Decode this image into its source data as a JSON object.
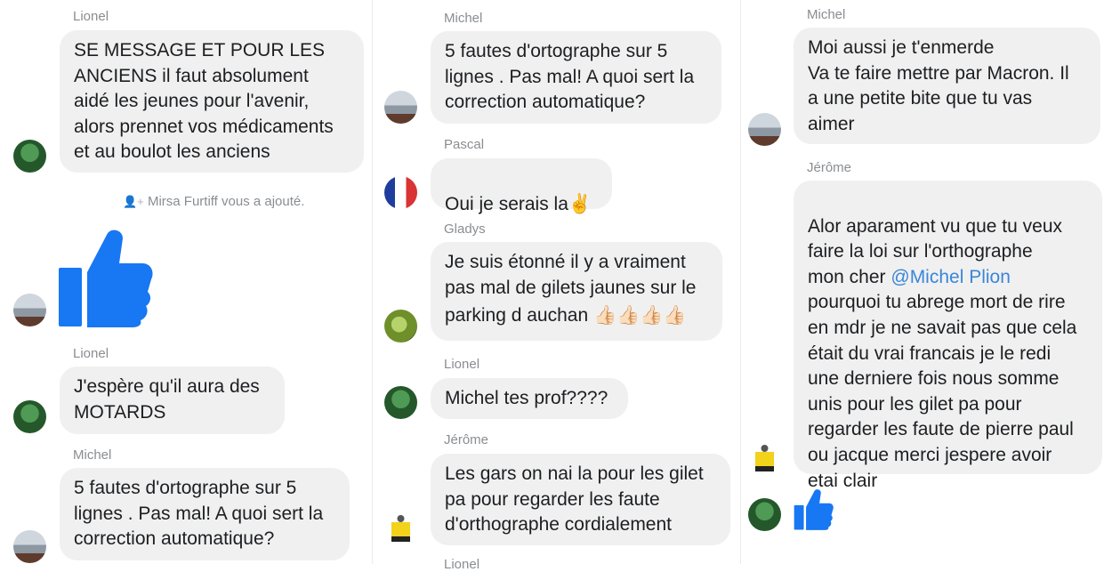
{
  "col1": {
    "name_lionel_1": "Lionel",
    "msg_lionel_1": "SE MESSAGE ET POUR LES\nANCIENS il faut absolument\naidé les jeunes pour l'avenir,\nalors prennet vos médicaments\net au boulot les anciens",
    "system_added": "Mirsa Furtiff vous a ajouté.",
    "name_lionel_2": "Lionel",
    "msg_lionel_2": "J'espère qu'il aura des\nMOTARDS",
    "name_michel": "Michel",
    "msg_michel": "5 fautes d'ortographe sur 5\nlignes . Pas mal! A quoi sert la\ncorrection automatique?"
  },
  "col2": {
    "name_michel": "Michel",
    "msg_michel": "5 fautes d'ortographe sur 5\nlignes . Pas mal! A quoi sert la\ncorrection automatique?",
    "name_pascal": "Pascal",
    "msg_pascal": "Oui je serais la",
    "name_gladys": "Gladys",
    "msg_gladys_line1": "Je suis étonné il y a vraiment",
    "msg_gladys_line2": "pas mal de gilets jaunes sur le",
    "msg_gladys_line3": "parking d auchan",
    "name_lionel": "Lionel",
    "msg_lionel": "Michel tes prof????",
    "name_jerome": "Jérôme",
    "msg_jerome": "Les gars on nai la pour les gilet\npa pour regarder les faute\nd'orthographe cordialement",
    "name_cut": "Lionel"
  },
  "col3": {
    "name_michel_cut": "Michel",
    "msg_michel": "Moi aussi je t'enmerde\nVa te faire mettre par Macron. Il\na une petite bite que tu vas\naimer",
    "name_jerome": "Jérôme",
    "msg_jerome_a": "Alor aparament vu que tu veux\nfaire la loi sur l'orthographe\nmon cher ",
    "msg_jerome_mention": "@Michel Plion",
    "msg_jerome_b": "\npourquoi tu abrege mort de rire\nen mdr je ne savait pas que cela\nétait du vrai francais je le redi\nune derniere fois nous somme\nunis pour les gilet pa pour\nregarder les faute de pierre paul\nou jacque merci jespere avoir\netai clair"
  },
  "colors": {
    "bubble": "#f0f0f0",
    "messenger_blue": "#1877f2",
    "name_gray": "#8a8d91",
    "mention": "#3a86d8"
  },
  "icons": {
    "like": "thumbs-up-icon",
    "emoji_victory": "victory-hand-emoji",
    "emoji_thumbs": "thumbs-up-emoji",
    "add_person": "add-person-icon"
  }
}
